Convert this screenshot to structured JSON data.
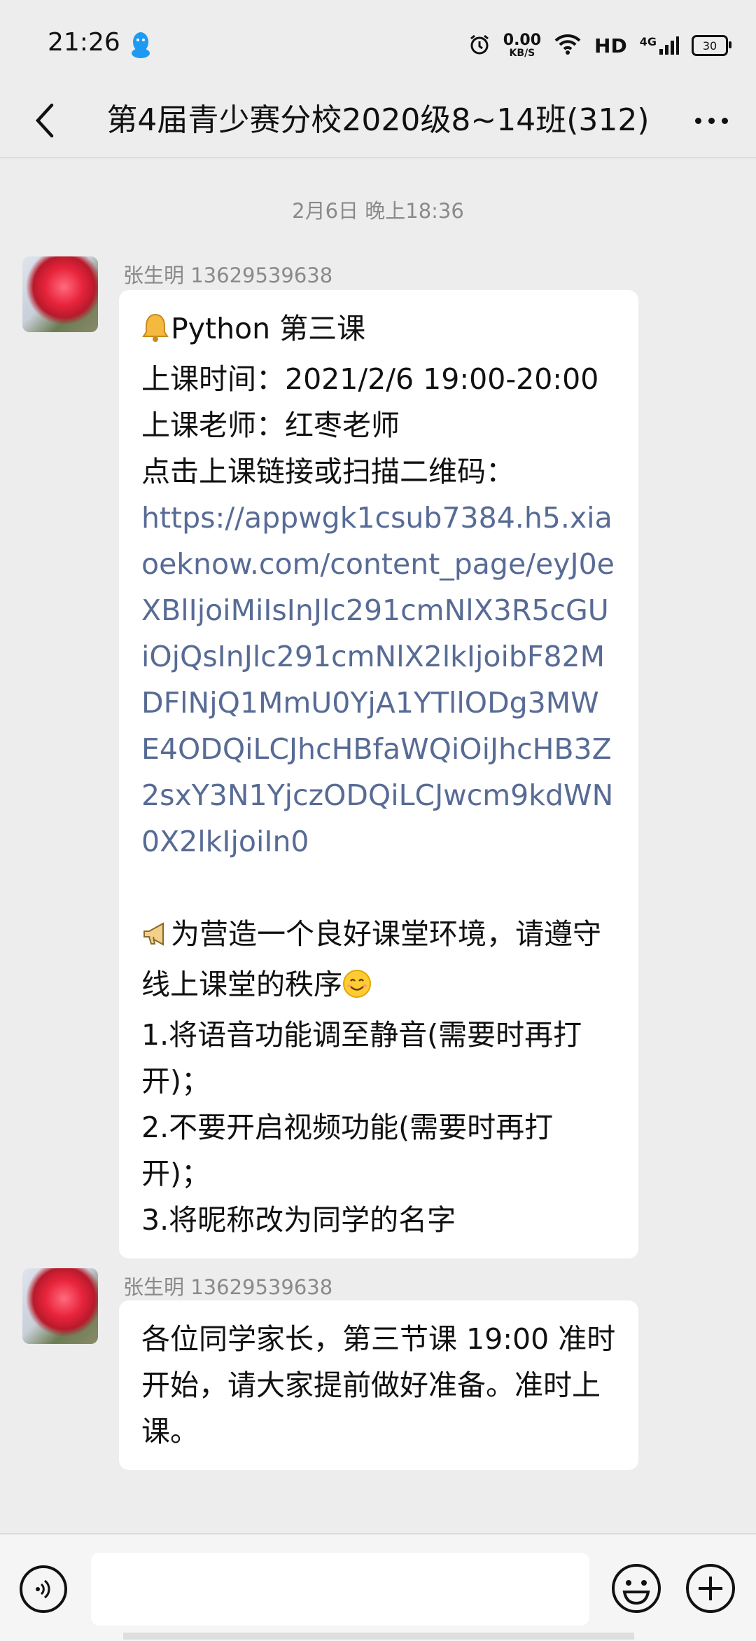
{
  "status_bar": {
    "time": "21:26",
    "net_speed_value": "0.00",
    "net_speed_unit": "KB/S",
    "hd_label": "HD",
    "network_label": "4G",
    "battery_level": "30"
  },
  "header": {
    "title": "第4届青少赛分校2020级8~14班(312)"
  },
  "chat": {
    "timestamp": "2月6日 晚上18:36",
    "messages": [
      {
        "sender": "张生明 13629539638",
        "lines": [
          "Python 第三课",
          "上课时间：2021/2/6 19:00-20:00",
          "上课老师：红枣老师",
          "点击上课链接或扫描二维码：",
          "https://appwgk1csub7384.h5.xiaoeknow.com/content_page/eyJ0eXBlIjoiMiIsInJlc291cmNlX3R5cGUiOjQsInJlc291cmNlX2lkIjoibF82MDFlNjQ1MmU0YjA1YTllODg3MWE4ODQiLCJhcHBfaWQiOiJhcHB3Z2sxY3N1YjczODQiLCJwcm9kdWN0X2lkIjoiIn0",
          "为营造一个良好课堂环境，请遵守线上课堂的秩序",
          "1.将语音功能调至静音(需要时再打开)；",
          "2.不要开启视频功能(需要时再打开)；",
          "3.将昵称改为同学的名字"
        ]
      },
      {
        "sender": "张生明 13629539638",
        "text": "各位同学家长，第三节课 19:00 准时开始，请大家提前做好准备。准时上课。"
      }
    ]
  },
  "input_bar": {
    "text_value": ""
  },
  "colors": {
    "background": "#ededed",
    "bubble": "#ffffff",
    "link": "#576b95",
    "meta_text": "#8a8a8a"
  }
}
